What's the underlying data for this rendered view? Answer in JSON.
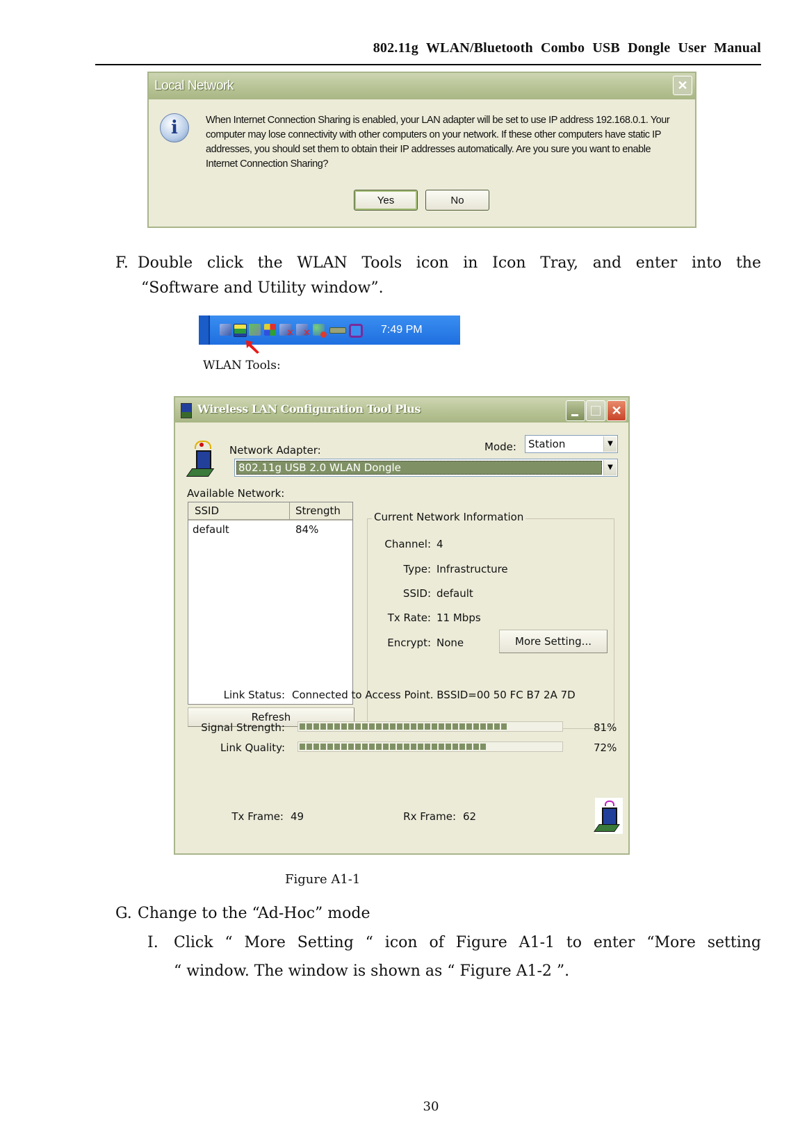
{
  "header": {
    "title": "802.11g WLAN/Bluetooth Combo USB Dongle User Manual"
  },
  "dialog": {
    "title": "Local Network",
    "close_icon": "close-x-icon",
    "info_icon": "info-icon",
    "message_lines": [
      "When Internet Connection Sharing is enabled, your LAN adapter will be set to use IP address 192.168.0.1. Your",
      "computer may lose connectivity with other computers on your network. If these other computers have static IP",
      "addresses, you should set them to obtain their IP addresses automatically.  Are you sure you want to enable",
      "Internet Connection Sharing?"
    ],
    "yes_label": "Yes",
    "no_label": "No"
  },
  "step_f": {
    "marker": "F.",
    "line1": "Double click the WLAN Tools icon in Icon Tray, and enter into the",
    "line2": "“Software and Utility window”."
  },
  "tray": {
    "clock": "7:49 PM",
    "icons": [
      "network-icon",
      "wlan-tools-icon",
      "bluetooth-icon",
      "display-icon",
      "network-disconnected-icon",
      "network-disconnected-icon",
      "messenger-icon",
      "usb-device-icon",
      "app-icon"
    ],
    "caption": "WLAN Tools:",
    "arrow_icon": "red-arrow-icon"
  },
  "wlan_window": {
    "title": "Wireless LAN Configuration Tool Plus",
    "network_adapter_label": "Network Adapter:",
    "mode_label": "Mode:",
    "mode_value": "Station",
    "adapter_value": "802.11g USB 2.0 WLAN Dongle",
    "available_network_label": "Available Network:",
    "table": {
      "columns": [
        "SSID",
        "Strength"
      ],
      "rows": [
        {
          "ssid": "default",
          "strength": "84%"
        }
      ]
    },
    "refresh_label": "Refresh",
    "current_info": {
      "group_label": "Current Network Information",
      "channel_label": "Channel:",
      "channel_value": "4",
      "type_label": "Type:",
      "type_value": "Infrastructure",
      "ssid_label": "SSID:",
      "ssid_value": "default",
      "txrate_label": "Tx Rate:",
      "txrate_value": "11 Mbps",
      "encrypt_label": "Encrypt:",
      "encrypt_value": "None",
      "more_setting_label": "More Setting..."
    },
    "link_status_label": "Link Status:",
    "link_status_value": "Connected to Access Point. BSSID=00 50 FC B7 2A 7D",
    "signal_strength_label": "Signal Strength:",
    "signal_strength_value": "81%",
    "signal_strength_fraction": 0.81,
    "link_quality_label": "Link Quality:",
    "link_quality_value": "72%",
    "link_quality_fraction": 0.72,
    "tx_frame_label": "Tx Frame:",
    "tx_frame_value": "49",
    "rx_frame_label": "Rx Frame:",
    "rx_frame_value": "62"
  },
  "figure_caption": "Figure A1-1",
  "step_g": {
    "marker": "G.",
    "text": "Change to the “Ad-Hoc” mode"
  },
  "step_g1": {
    "marker": "I.",
    "line1": "Click “ More Setting “ icon of Figure A1-1 to enter “More setting",
    "line2": "“ window. The window is shown as “ Figure A1-2 ”."
  },
  "page_number": "30"
}
